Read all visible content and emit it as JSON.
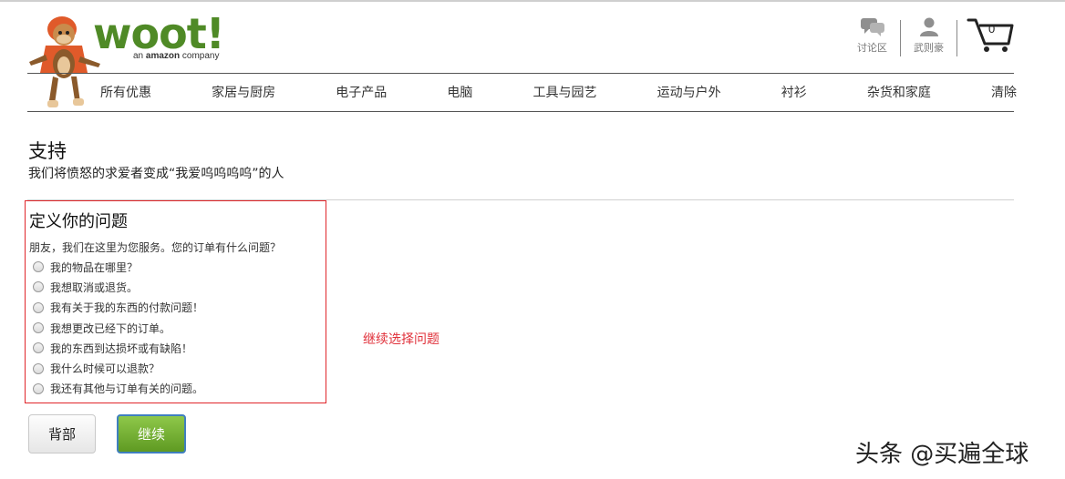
{
  "brand": {
    "name": "woot!",
    "tagline_prefix": "an ",
    "tagline_brand": "amazon",
    "tagline_suffix": " company",
    "color": "#4f8a26"
  },
  "header": {
    "forum_label": "讨论区",
    "user_label": "武则豪",
    "cart_count": "0"
  },
  "nav": {
    "items": [
      "所有优惠",
      "家居与厨房",
      "电子产品",
      "电脑",
      "工具与园艺",
      "运动与户外",
      "衬衫",
      "杂货和家庭",
      "清除"
    ]
  },
  "support": {
    "title": "支持",
    "subtitle": "我们将愤怒的求爱者变成“我爱呜呜呜呜”的人"
  },
  "problem": {
    "title": "定义你的问题",
    "question": "朋友，我们在这里为您服务。您的订单有什么问题？",
    "options": [
      "我的物品在哪里？",
      "我想取消或退货。",
      "我有关于我的东西的付款问题！",
      "我想更改已经下的订单。",
      "我的东西到达损坏或有缺陷！",
      "我什么时候可以退款？",
      "我还有其他与订单有关的问题。"
    ],
    "border_color": "#e0252a"
  },
  "annotation": "继续选择问题",
  "buttons": {
    "back": "背部",
    "continue": "继续"
  },
  "watermark": "头条 @买遍全球"
}
